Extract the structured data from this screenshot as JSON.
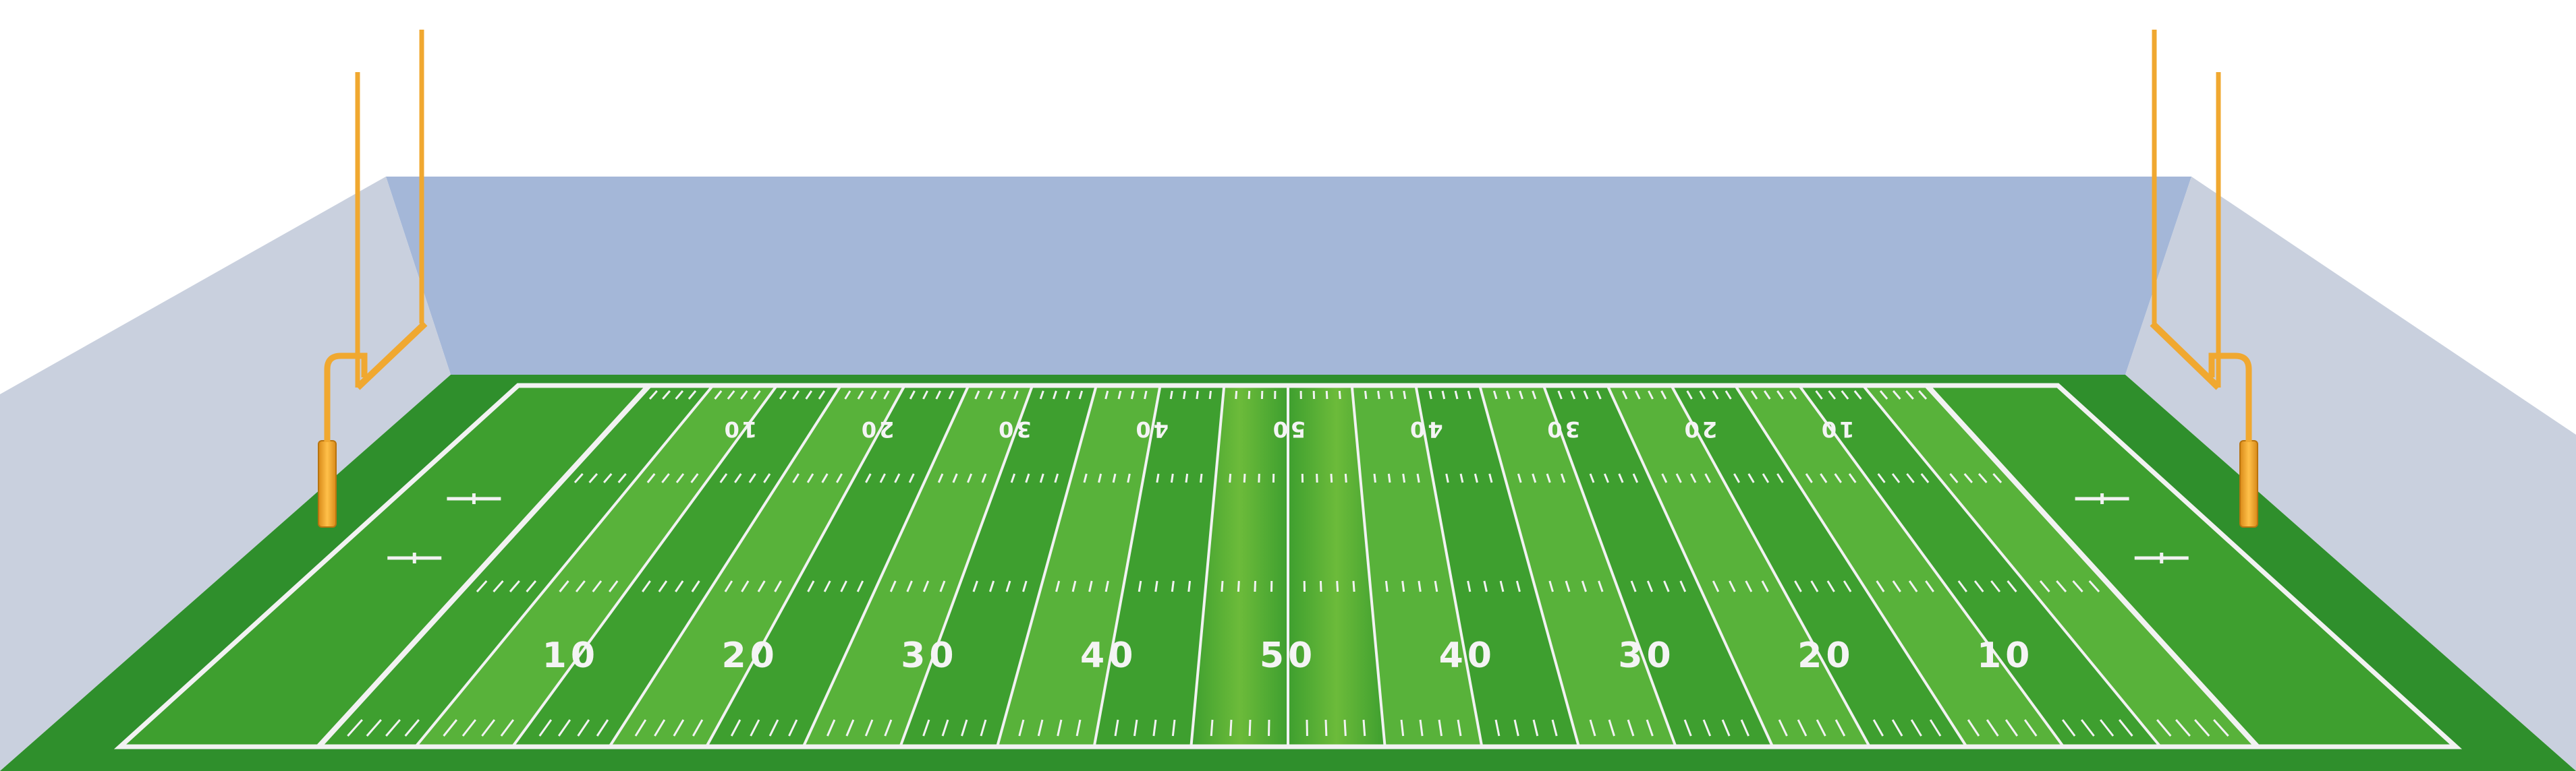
{
  "scene": {
    "subject": "american-football-field",
    "colors": {
      "background": "#ffffff",
      "stands_back": "#a4b7d8",
      "stands_side": "#c9d0de",
      "turf_outer": "#2f8f2c",
      "turf_field": "#3e9f2f",
      "turf_stripe_light": "#58b23a",
      "turf_center": "#6cbb3a",
      "lines": "#f2f2f2",
      "goalpost": "#f0a830"
    }
  },
  "yard_numbers": {
    "near": [
      "10",
      "20",
      "30",
      "40",
      "50",
      "40",
      "30",
      "20",
      "10"
    ],
    "far": [
      "10",
      "20",
      "30",
      "40",
      "50",
      "40",
      "30",
      "20",
      "10"
    ]
  },
  "goalposts": [
    {
      "side": "left",
      "icon": "goalpost-icon"
    },
    {
      "side": "right",
      "icon": "goalpost-icon"
    }
  ]
}
